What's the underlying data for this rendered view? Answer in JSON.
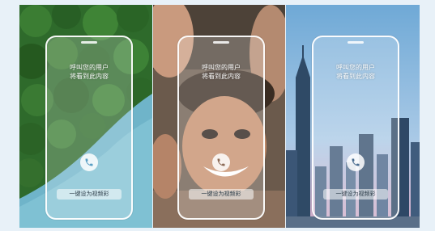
{
  "screens": [
    {
      "background": "forest-and-river-photo",
      "caller_line1": "呼叫您的用户",
      "caller_line2": "将看到此内容",
      "set_label": "一键设为视频彩",
      "icon": "phone-icon"
    },
    {
      "background": "smiling-child-photo",
      "caller_line1": "呼叫您的用户",
      "caller_line2": "将看到此内容",
      "set_label": "一键设为视频彩",
      "icon": "phone-icon"
    },
    {
      "background": "city-skyline-photo",
      "caller_line1": "呼叫您的用户",
      "caller_line2": "将看到此内容",
      "set_label": "一键设为视频彩",
      "icon": "phone-icon"
    }
  ],
  "colors": {
    "page_bg": "#e8f1f8",
    "forest": "#2f6b2a",
    "water": "#6fb4c9",
    "sky": "#7fb6dc"
  }
}
